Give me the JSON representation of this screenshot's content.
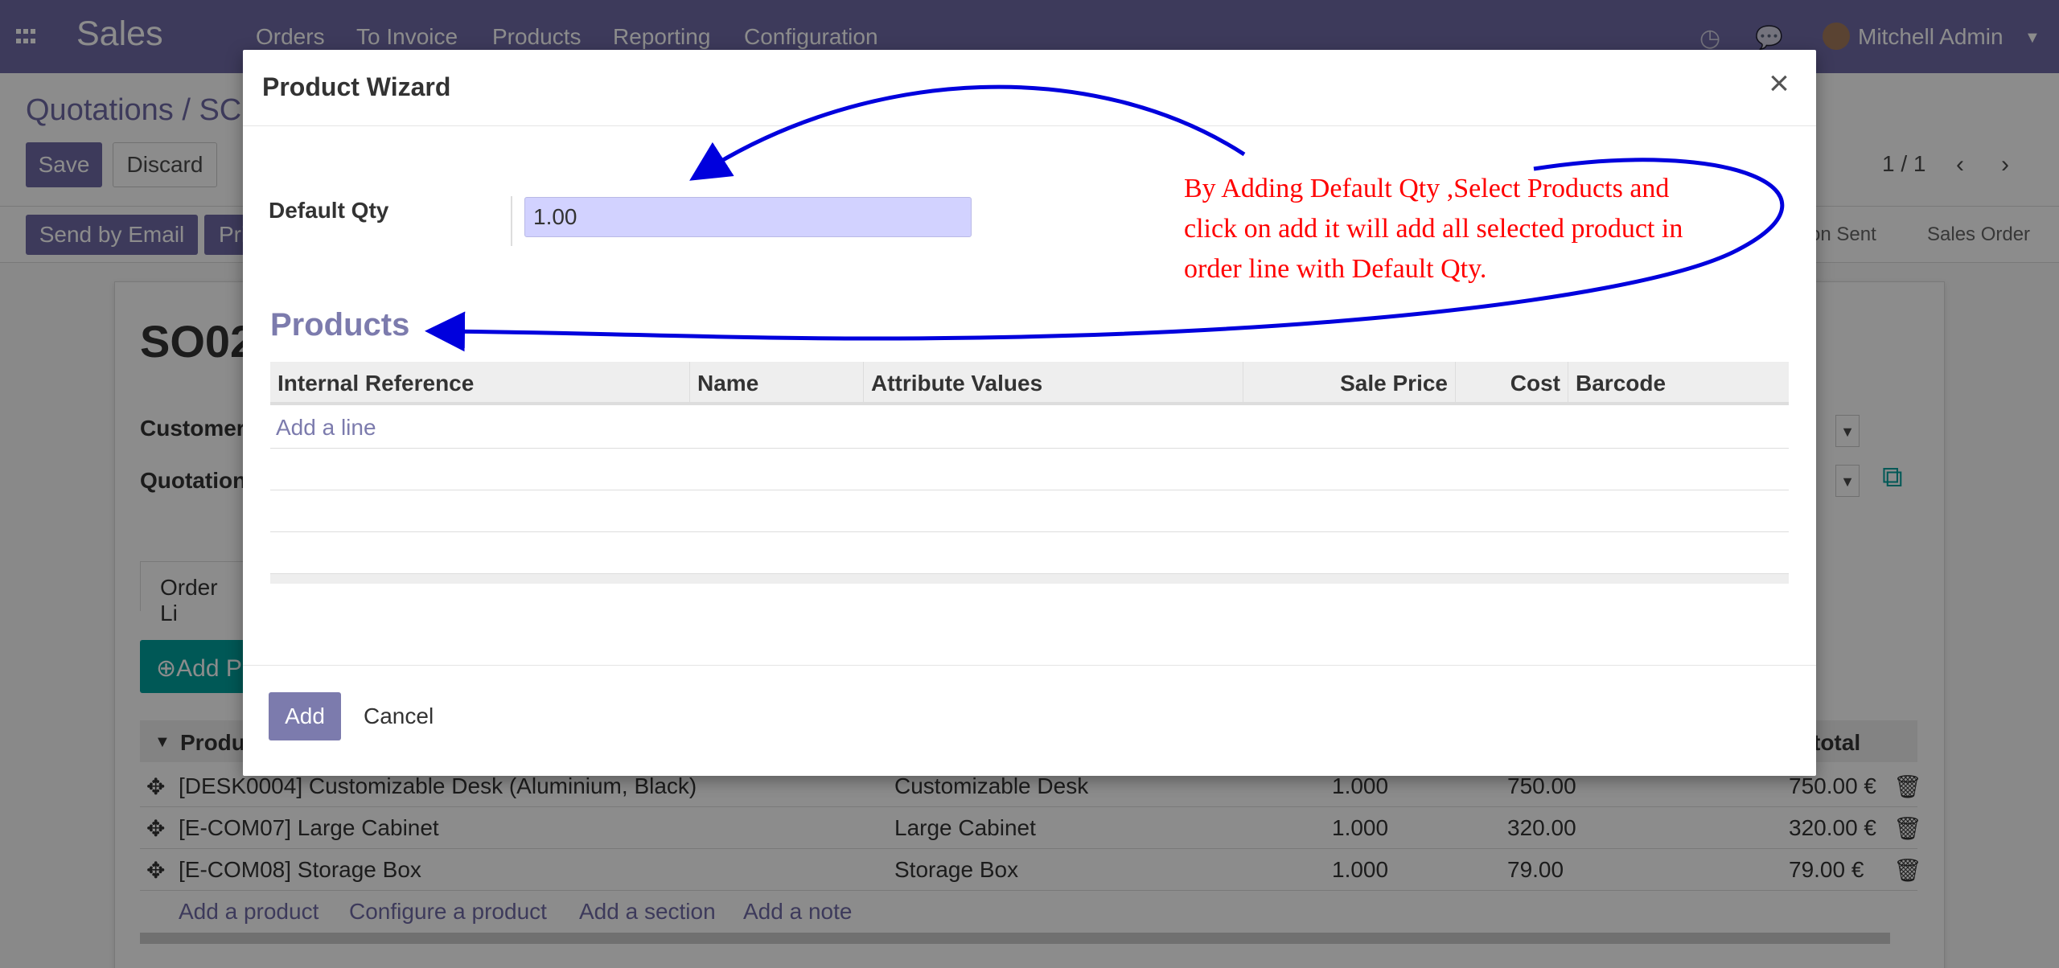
{
  "navbar": {
    "brand": "Sales",
    "menu": [
      "Orders",
      "To Invoice",
      "Products",
      "Reporting",
      "Configuration"
    ],
    "user": "Mitchell Admin"
  },
  "control_panel": {
    "breadcrumb": "Quotations / SC",
    "save_label": "Save",
    "discard_label": "Discard",
    "pager": "1 / 1",
    "send_email_label": "Send by Email",
    "print_label": "Pri",
    "stages": [
      "on Sent",
      "Sales Order"
    ]
  },
  "form": {
    "so_name": "SO02",
    "customer_label": "Customer",
    "quotation_label": "Quotation",
    "tab_label": "Order Li",
    "add_product_label": "Add P",
    "header_product": "Produ",
    "header_subtotal": "total",
    "order_lines": [
      {
        "product": "[DESK0004] Customizable Desk (Aluminium, Black)",
        "description": "Customizable Desk",
        "qty": "1.000",
        "price": "750.00",
        "subtotal": "750.00 €"
      },
      {
        "product": "[E-COM07] Large Cabinet",
        "description": "Large Cabinet",
        "qty": "1.000",
        "price": "320.00",
        "subtotal": "320.00 €"
      },
      {
        "product": "[E-COM08] Storage Box",
        "description": "Storage Box",
        "qty": "1.000",
        "price": "79.00",
        "subtotal": "79.00 €"
      }
    ],
    "links": [
      "Add a product",
      "Configure a product",
      "Add a section",
      "Add a note"
    ]
  },
  "modal": {
    "title": "Product Wizard",
    "close_glyph": "×",
    "default_qty_label": "Default Qty",
    "default_qty_value": "1.00",
    "products_title": "Products",
    "columns": [
      "Internal Reference",
      "Name",
      "Attribute Values",
      "Sale Price",
      "Cost",
      "Barcode"
    ],
    "add_line_label": "Add a line",
    "add_button": "Add",
    "cancel_button": "Cancel",
    "annotation_lines": [
      "By Adding Default Qty ,Select Products and",
      "click on add it will add all selected product in",
      "order line with Default Qty."
    ]
  },
  "colors": {
    "navbar": "#6f6aa6",
    "primary": "#7c7bad",
    "input_highlight": "#d2d2ff",
    "annotation_text": "#ff0000",
    "arrow": "#0000dd"
  }
}
